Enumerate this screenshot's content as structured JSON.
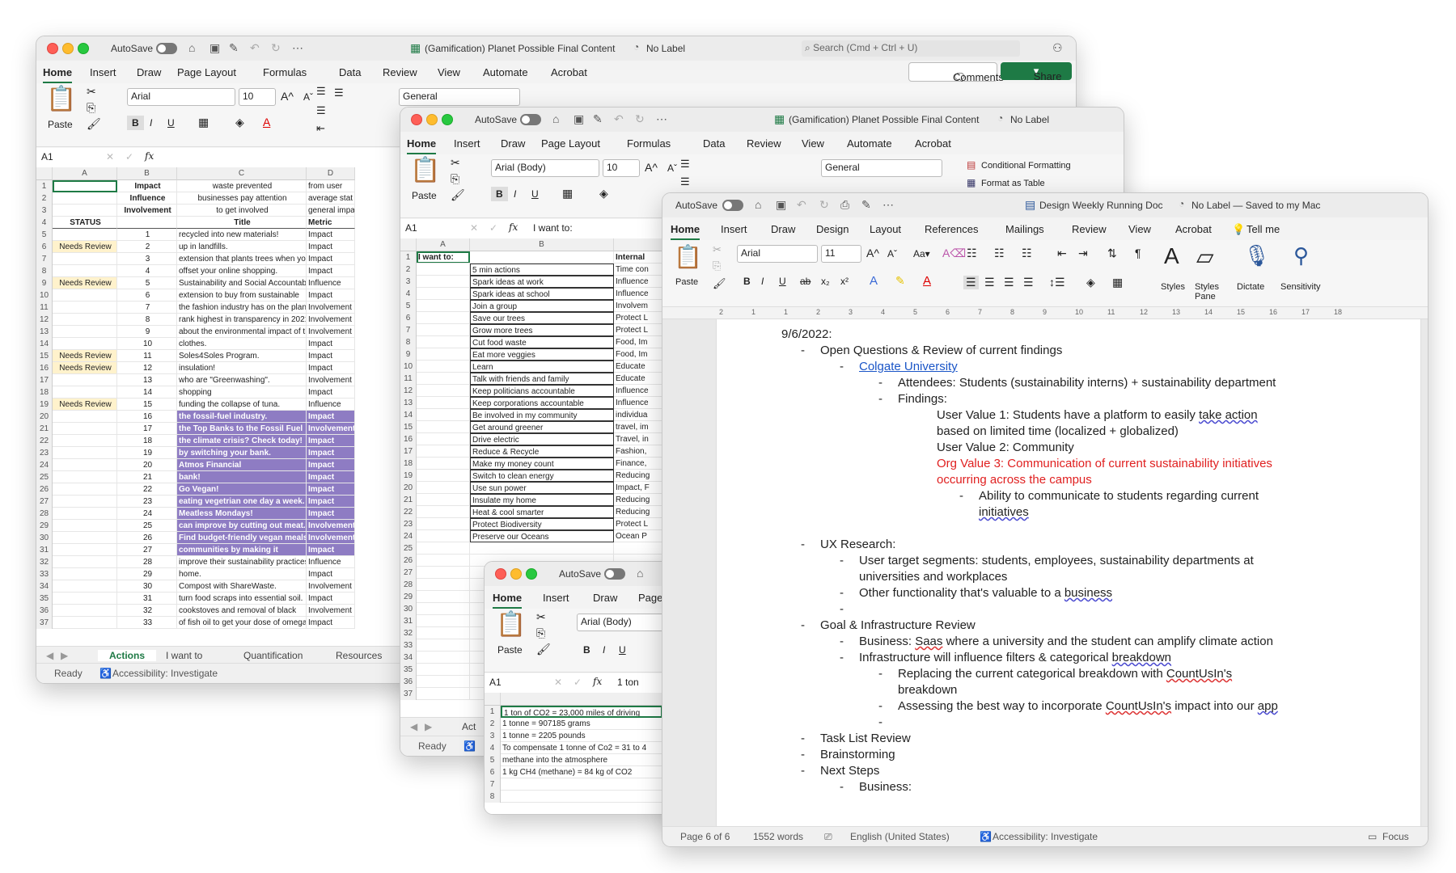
{
  "excel1": {
    "autosave": "AutoSave",
    "title": "(Gamification) Planet Possible Final Content",
    "label": "No Label",
    "search": "Search (Cmd + Ctrl + U)",
    "menu": [
      "Home",
      "Insert",
      "Draw",
      "Page Layout",
      "Formulas",
      "Data",
      "Review",
      "View",
      "Automate",
      "Acrobat"
    ],
    "comments": "Comments",
    "share": "Share",
    "font": "Arial",
    "size": "10",
    "format": "General",
    "paste": "Paste",
    "namebox": "A1",
    "cols": [
      "A",
      "B",
      "C",
      "D"
    ],
    "rows": [
      {
        "n": "1",
        "a": "",
        "b": "Impact",
        "c": "waste prevented",
        "d": "from user"
      },
      {
        "n": "2",
        "a": "",
        "b": "Influence",
        "c": "businesses pay attention",
        "d": "average stat"
      },
      {
        "n": "3",
        "a": "",
        "b": "Involvement",
        "c": "to get involved",
        "d": "general impact"
      },
      {
        "n": "4",
        "a": "STATUS",
        "b": "",
        "c": "Title",
        "d": "Metric"
      },
      {
        "n": "5",
        "a": "",
        "b": "1",
        "c": "recycled into new materials!",
        "d": "Impact"
      },
      {
        "n": "6",
        "a": "Needs Review",
        "b": "2",
        "c": "up in landfills.",
        "d": "Impact"
      },
      {
        "n": "7",
        "a": "",
        "b": "3",
        "c": "extension that plants trees when you",
        "d": "Impact"
      },
      {
        "n": "8",
        "a": "",
        "b": "4",
        "c": "offset your online shopping.",
        "d": "Impact"
      },
      {
        "n": "9",
        "a": "Needs Review",
        "b": "5",
        "c": "Sustainability and Social Accountability",
        "d": "Influence"
      },
      {
        "n": "10",
        "a": "",
        "b": "6",
        "c": "extension to buy from sustainable",
        "d": "Impact"
      },
      {
        "n": "11",
        "a": "",
        "b": "7",
        "c": "the fashion industry has on the planet.",
        "d": "Involvement"
      },
      {
        "n": "12",
        "a": "",
        "b": "8",
        "c": "rank highest in transparency in 2021.",
        "d": "Involvement"
      },
      {
        "n": "13",
        "a": "",
        "b": "9",
        "c": "about the environmental impact of the",
        "d": "Involvement"
      },
      {
        "n": "14",
        "a": "",
        "b": "10",
        "c": "clothes.",
        "d": "Impact"
      },
      {
        "n": "15",
        "a": "Needs Review",
        "b": "11",
        "c": "Soles4Soles Program.",
        "d": "Impact"
      },
      {
        "n": "16",
        "a": "Needs Review",
        "b": "12",
        "c": "insulation!",
        "d": "Impact"
      },
      {
        "n": "17",
        "a": "",
        "b": "13",
        "c": "who are \"Greenwashing\".",
        "d": "Involvement"
      },
      {
        "n": "18",
        "a": "",
        "b": "14",
        "c": "shopping",
        "d": "Impact"
      },
      {
        "n": "19",
        "a": "Needs Review",
        "b": "15",
        "c": "funding the collapse of tuna.",
        "d": "Influence"
      },
      {
        "n": "20",
        "a": "",
        "b": "16",
        "c": "the fossil-fuel industry.",
        "d": "Impact"
      },
      {
        "n": "21",
        "a": "",
        "b": "17",
        "c": "the Top Banks to the Fossil Fuel",
        "d": "Involvement"
      },
      {
        "n": "22",
        "a": "",
        "b": "18",
        "c": "the climate crisis? Check today!",
        "d": "Impact"
      },
      {
        "n": "23",
        "a": "",
        "b": "19",
        "c": "by switching your bank.",
        "d": "Impact"
      },
      {
        "n": "24",
        "a": "",
        "b": "20",
        "c": "Atmos Financial",
        "d": "Impact"
      },
      {
        "n": "25",
        "a": "",
        "b": "21",
        "c": "bank!",
        "d": "Impact"
      },
      {
        "n": "26",
        "a": "",
        "b": "22",
        "c": "Go Vegan!",
        "d": "Impact"
      },
      {
        "n": "27",
        "a": "",
        "b": "23",
        "c": "eating vegetrian one day a week.",
        "d": "Impact"
      },
      {
        "n": "28",
        "a": "",
        "b": "24",
        "c": "Meatless Mondays!",
        "d": "Impact"
      },
      {
        "n": "29",
        "a": "",
        "b": "25",
        "c": "can improve by cutting out meat.",
        "d": "Involvement"
      },
      {
        "n": "30",
        "a": "",
        "b": "26",
        "c": "Find budget-friendly vegan meals.",
        "d": "Involvement"
      },
      {
        "n": "31",
        "a": "",
        "b": "27",
        "c": "communities by making it",
        "d": "Impact"
      },
      {
        "n": "32",
        "a": "",
        "b": "28",
        "c": "improve their sustainability practices.",
        "d": "Influence"
      },
      {
        "n": "33",
        "a": "",
        "b": "29",
        "c": "home.",
        "d": "Impact"
      },
      {
        "n": "34",
        "a": "",
        "b": "30",
        "c": "Compost with ShareWaste.",
        "d": "Involvement"
      },
      {
        "n": "35",
        "a": "",
        "b": "31",
        "c": "turn food scraps into essential soil.",
        "d": "Impact"
      },
      {
        "n": "36",
        "a": "",
        "b": "32",
        "c": "cookstoves and removal of black",
        "d": "Involvement"
      },
      {
        "n": "37",
        "a": "",
        "b": "33",
        "c": "of fish oil to get your dose of omega-3.",
        "d": "Impact"
      }
    ],
    "tabs": [
      "Actions",
      "I want to",
      "Quantification",
      "Resources"
    ],
    "status": "Ready",
    "accessibility": "Accessibility: Investigate"
  },
  "excel2": {
    "autosave": "AutoSave",
    "title": "(Gamification) Planet Possible Final Content",
    "label": "No Label",
    "menu": [
      "Home",
      "Insert",
      "Draw",
      "Page Layout",
      "Formulas",
      "Data",
      "Review",
      "View",
      "Automate",
      "Acrobat"
    ],
    "font": "Arial (Body)",
    "size": "10",
    "format": "General",
    "paste": "Paste",
    "cond_format": "Conditional Formatting",
    "format_table": "Format as Table",
    "namebox": "A1",
    "formula": "I want to:",
    "cols": [
      "A",
      "B"
    ],
    "rows": [
      {
        "n": "1",
        "b": "I want to:",
        "c": "Internal"
      },
      {
        "n": "2",
        "b": "5 min actions",
        "c": "Time con"
      },
      {
        "n": "3",
        "b": "Spark ideas at work",
        "c": "Influence"
      },
      {
        "n": "4",
        "b": "Spark ideas at school",
        "c": "Influence"
      },
      {
        "n": "5",
        "b": "Join a group",
        "c": "Involvem"
      },
      {
        "n": "6",
        "b": "Save our trees",
        "c": "Protect L"
      },
      {
        "n": "7",
        "b": "Grow more trees",
        "c": "Protect L"
      },
      {
        "n": "8",
        "b": "Cut food waste",
        "c": "Food, Im"
      },
      {
        "n": "9",
        "b": "Eat more veggies",
        "c": "Food, Im"
      },
      {
        "n": "10",
        "b": "Learn",
        "c": "Educate"
      },
      {
        "n": "11",
        "b": "Talk with friends and family",
        "c": "Educate"
      },
      {
        "n": "12",
        "b": "Keep politicians accountable",
        "c": "Influence"
      },
      {
        "n": "13",
        "b": "Keep corporations accountable",
        "c": "Influence"
      },
      {
        "n": "14",
        "b": "Be involved in my community",
        "c": "individua"
      },
      {
        "n": "15",
        "b": "Get around greener",
        "c": "travel, im"
      },
      {
        "n": "16",
        "b": "Drive electric",
        "c": "Travel, in"
      },
      {
        "n": "17",
        "b": "Reduce & Recycle",
        "c": "Fashion,"
      },
      {
        "n": "18",
        "b": "Make my money count",
        "c": "Finance,"
      },
      {
        "n": "19",
        "b": "Switch to clean energy",
        "c": "Reducing"
      },
      {
        "n": "20",
        "b": "Use sun power",
        "c": "Impact, F"
      },
      {
        "n": "21",
        "b": "Insulate my home",
        "c": "Reducing"
      },
      {
        "n": "22",
        "b": "Heat & cool smarter",
        "c": "Reducing"
      },
      {
        "n": "23",
        "b": "Protect Biodiversity",
        "c": "Protect L"
      },
      {
        "n": "24",
        "b": "Preserve our Oceans",
        "c": "Ocean P"
      },
      {
        "n": "25",
        "b": "",
        "c": ""
      },
      {
        "n": "26",
        "b": "",
        "c": ""
      },
      {
        "n": "27",
        "b": "",
        "c": ""
      },
      {
        "n": "28",
        "b": "",
        "c": ""
      },
      {
        "n": "29",
        "b": "",
        "c": ""
      },
      {
        "n": "30",
        "b": "",
        "c": ""
      },
      {
        "n": "31",
        "b": "",
        "c": ""
      },
      {
        "n": "32",
        "b": "",
        "c": ""
      },
      {
        "n": "33",
        "b": "",
        "c": ""
      },
      {
        "n": "34",
        "b": "",
        "c": ""
      },
      {
        "n": "35",
        "b": "",
        "c": ""
      },
      {
        "n": "36",
        "b": "",
        "c": ""
      },
      {
        "n": "37",
        "b": "",
        "c": ""
      }
    ],
    "tab": "Act",
    "status": "Ready"
  },
  "excel3": {
    "autosave": "AutoSave",
    "menu": [
      "Home",
      "Insert",
      "Draw",
      "Page"
    ],
    "font": "Arial (Body)",
    "paste": "Paste",
    "namebox": "A1",
    "formula": "1 ton",
    "col": "A",
    "rows": [
      {
        "n": "1",
        "v": "1 ton of CO2  = 23,000 miles of driving"
      },
      {
        "n": "2",
        "v": "1 tonne = 907185 grams"
      },
      {
        "n": "3",
        "v": "1 tonne = 2205 pounds"
      },
      {
        "n": "4",
        "v": "To compensate 1 tonne of Co2 = 31 to 4"
      },
      {
        "n": "5",
        "v": "methane into the atmosphere"
      },
      {
        "n": "6",
        "v": "1 kg CH4 (methane) = 84 kg of CO2"
      },
      {
        "n": "7",
        "v": ""
      },
      {
        "n": "8",
        "v": ""
      }
    ]
  },
  "word": {
    "autosave": "AutoSave",
    "title": "Design Weekly Running Doc",
    "label": "No Label — Saved to my Mac",
    "menu": [
      "Home",
      "Insert",
      "Draw",
      "Design",
      "Layout",
      "References",
      "Mailings",
      "Review",
      "View",
      "Acrobat",
      "Tell me"
    ],
    "font": "Arial",
    "size": "11",
    "paste": "Paste",
    "styles": "Styles",
    "styles_pane": "Styles Pane",
    "dictate": "Dictate",
    "sensitivity": "Sensitivity",
    "ruler": [
      "2",
      "1",
      "1",
      "2",
      "3",
      "4",
      "5",
      "6",
      "7",
      "8",
      "9",
      "10",
      "11",
      "12",
      "13",
      "14",
      "15",
      "16",
      "17",
      "18"
    ],
    "lines": {
      "date": "9/6/2022:",
      "l1": "Open Questions & Review of current findings",
      "colgate": "Colgate University",
      "attendees": "Attendees: Students (sustainability interns) + sustainability department",
      "findings": "Findings:",
      "uv1a": "User Value 1: Students have a platform to easily ",
      "uv1b": "take action",
      "uv1c": "based on limited time (localized + globalized)",
      "uv2": "User Value 2: Community",
      "ov3a": "Org Value 3: Communication of current sustainability initiatives",
      "ov3b": "occurring across the campus",
      "ability": "Ability to communicate to students regarding current",
      "initiatives": "initiatives",
      "ux": "UX Research:",
      "target1": "User target segments: students, employees, sustainability departments at",
      "target2": "universities and workplaces",
      "other_a": "Other functionality that's valuable to a ",
      "other_b": "business",
      "goal": "Goal & Infrastructure Review",
      "biz_a": "Business: ",
      "biz_b": "Saas",
      "biz_c": " where a university and the student can amplify climate action",
      "infra_a": "Infrastructure will influence filters & categorical ",
      "infra_b": "breakdown",
      "replace_a": "Replacing the current categorical breakdown with ",
      "replace_b": "CountUsIn's",
      "replace_c": "breakdown",
      "assess_a": "Assessing the best way to incorporate ",
      "assess_b": "CountUsIn's",
      "assess_c": " impact into our ",
      "assess_d": "app",
      "task": "Task List Review",
      "brain": "Brainstorming",
      "next": "Next Steps",
      "business": "Business:"
    },
    "status": {
      "page": "Page 6 of 6",
      "words": "1552 words",
      "lang": "English (United States)",
      "accessibility": "Accessibility: Investigate",
      "focus": "Focus"
    }
  }
}
